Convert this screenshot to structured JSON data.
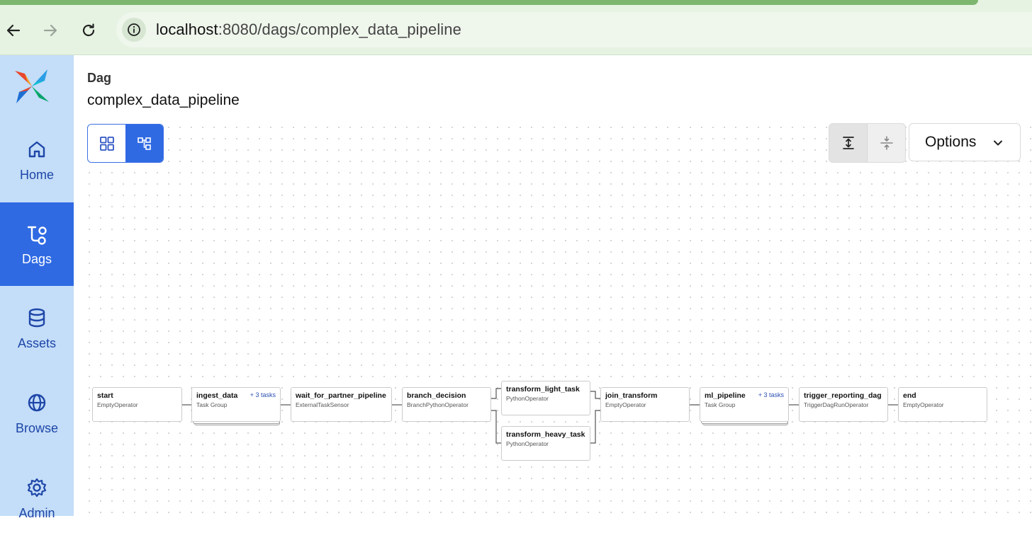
{
  "browser": {
    "url_host": "localhost",
    "url_rest": ":8080/dags/complex_data_pipeline",
    "back_icon": "arrow-left-icon",
    "forward_icon": "arrow-right-icon",
    "reload_icon": "reload-icon",
    "info_icon": "info-icon"
  },
  "sidebar": {
    "items": [
      {
        "label": "Home",
        "icon": "home-icon",
        "active": false
      },
      {
        "label": "Dags",
        "icon": "dag-icon",
        "active": true
      },
      {
        "label": "Assets",
        "icon": "database-icon",
        "active": false
      },
      {
        "label": "Browse",
        "icon": "globe-icon",
        "active": false
      },
      {
        "label": "Admin",
        "icon": "gear-icon",
        "active": false
      }
    ]
  },
  "header": {
    "crumb": "Dag",
    "title": "complex_data_pipeline"
  },
  "toolbar": {
    "views": [
      "grid-view-icon",
      "graph-view-icon"
    ],
    "active_view": "graph",
    "direction": [
      "expand-vertical-icon",
      "collapse-vertical-icon"
    ],
    "options_label": "Options"
  },
  "graph": {
    "nodes": [
      {
        "name": "start",
        "type": "EmptyOperator"
      },
      {
        "name": "ingest_data",
        "type": "Task Group",
        "count": "+ 3 tasks"
      },
      {
        "name": "wait_for_partner_pipeline",
        "type": "ExternalTaskSensor"
      },
      {
        "name": "branch_decision",
        "type": "BranchPythonOperator"
      },
      {
        "name": "transform_light_task",
        "type": "PythonOperator"
      },
      {
        "name": "transform_heavy_task",
        "type": "PythonOperator"
      },
      {
        "name": "join_transform",
        "type": "EmptyOperator"
      },
      {
        "name": "ml_pipeline",
        "type": "Task Group",
        "count": "+ 3 tasks"
      },
      {
        "name": "trigger_reporting_dag",
        "type": "TriggerDagRunOperator"
      },
      {
        "name": "end",
        "type": "EmptyOperator"
      }
    ],
    "colors": {
      "accent": "#2f6ae3",
      "sidebar": "#c4ddf8",
      "edge": "#555555"
    }
  }
}
